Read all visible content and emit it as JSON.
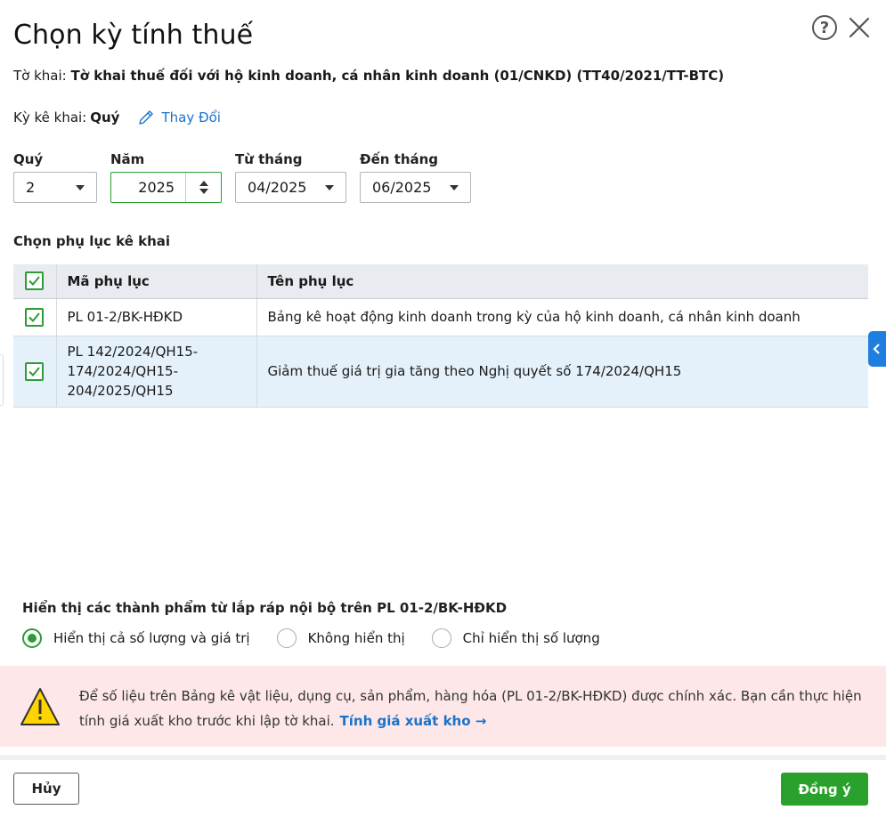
{
  "dialog": {
    "title": "Chọn kỳ tính thuế"
  },
  "declaration": {
    "label": "Tờ khai:",
    "value": "Tờ khai thuế đối với hộ kinh doanh, cá nhân kinh doanh (01/CNKD) (TT40/2021/TT-BTC)"
  },
  "period_type": {
    "label": "Kỳ kê khai:",
    "value": "Quý",
    "change_label": "Thay Đổi"
  },
  "fields": {
    "quarter": {
      "label": "Quý",
      "value": "2"
    },
    "year": {
      "label": "Năm",
      "value": "2025"
    },
    "from_month": {
      "label": "Từ tháng",
      "value": "04/2025"
    },
    "to_month": {
      "label": "Đến tháng",
      "value": "06/2025"
    }
  },
  "appendix": {
    "section_title": "Chọn phụ lục kê khai",
    "columns": [
      "Mã phụ lục",
      "Tên phụ lục"
    ],
    "rows": [
      {
        "code": "PL 01-2/BK-HĐKD",
        "name": "Bảng kê hoạt động kinh doanh trong kỳ của hộ kinh doanh, cá nhân kinh doanh",
        "checked": true
      },
      {
        "code_lines": [
          "PL 142/2024/QH15-",
          "174/2024/QH15-",
          "204/2025/QH15"
        ],
        "name": "Giảm thuế giá trị gia tăng theo Nghị quyết số 174/2024/QH15",
        "checked": true
      }
    ]
  },
  "display_option": {
    "title": "Hiển thị các thành phẩm từ lắp ráp nội bộ trên PL 01-2/BK-HĐKD",
    "options": [
      {
        "label": "Hiển thị cả số lượng và giá trị",
        "selected": true
      },
      {
        "label": "Không hiển thị",
        "selected": false
      },
      {
        "label": "Chỉ hiển thị số lượng",
        "selected": false
      }
    ]
  },
  "warning": {
    "text": "Để số liệu trên Bảng kê vật liệu, dụng cụ, sản phẩm, hàng hóa (PL 01-2/BK-HĐKD) được chính xác. Bạn cần thực hiện tính giá xuất kho trước khi lập tờ khai.",
    "link_label": "Tính giá xuất kho →"
  },
  "footer": {
    "cancel_label": "Hủy",
    "ok_label": "Đồng ý"
  },
  "colors": {
    "accent_green": "#2aa12c",
    "link_blue": "#1a73c9",
    "warning_bg": "#fde7e9",
    "selected_row_bg": "#e4f1fb"
  }
}
